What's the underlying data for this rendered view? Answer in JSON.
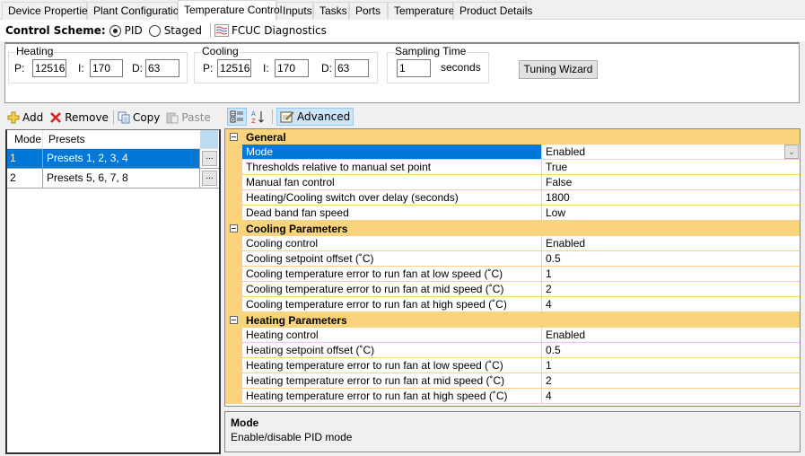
{
  "tabs": [
    {
      "label": "Device Properties",
      "active": false
    },
    {
      "label": "Plant Configuration",
      "active": false
    },
    {
      "label": "Temperature Control",
      "active": true
    },
    {
      "label": "Inputs",
      "active": false
    },
    {
      "label": "Tasks",
      "active": false
    },
    {
      "label": "Ports",
      "active": false
    },
    {
      "label": "Temperature",
      "active": false
    },
    {
      "label": "Product Details",
      "active": false
    }
  ],
  "scheme": {
    "label": "Control Scheme:",
    "options": [
      {
        "label": "PID",
        "selected": true
      },
      {
        "label": "Staged",
        "selected": false
      }
    ],
    "diagnostics_label": "FCUC Diagnostics"
  },
  "pid": {
    "heating": {
      "title": "Heating",
      "p_label": "P:",
      "i_label": "I:",
      "d_label": "D:",
      "p": "12516",
      "i": "170",
      "d": "63"
    },
    "cooling": {
      "title": "Cooling",
      "p_label": "P:",
      "i_label": "I:",
      "d_label": "D:",
      "p": "12516",
      "i": "170",
      "d": "63"
    },
    "sampling": {
      "title": "Sampling Time",
      "value": "1",
      "unit": "seconds"
    },
    "tuning_wizard_label": "Tuning Wizard"
  },
  "left_toolbar": {
    "add": "Add",
    "remove": "Remove",
    "copy": "Copy",
    "paste": "Paste"
  },
  "modes_grid": {
    "columns": [
      "Mode",
      "Presets"
    ],
    "rows": [
      {
        "mode": "1",
        "presets": "Presets 1, 2, 3, 4",
        "selected": true,
        "button": "..."
      },
      {
        "mode": "2",
        "presets": "Presets 5, 6, 7, 8",
        "selected": false,
        "button": "..."
      }
    ]
  },
  "right_toolbar": {
    "advanced_label": "Advanced"
  },
  "property_grid": {
    "categories": [
      {
        "name": "General",
        "rows": [
          {
            "name": "Mode",
            "value": "Enabled",
            "selected": true
          },
          {
            "name": "Thresholds relative to manual set point",
            "value": "True"
          },
          {
            "name": "Manual fan control",
            "value": "False"
          },
          {
            "name": "Heating/Cooling switch over delay (seconds)",
            "value": "1800"
          },
          {
            "name": "Dead band fan speed",
            "value": "Low"
          }
        ]
      },
      {
        "name": "Cooling Parameters",
        "rows": [
          {
            "name": "Cooling control",
            "value": "Enabled"
          },
          {
            "name": "Cooling setpoint offset (˚C)",
            "value": "0.5"
          },
          {
            "name": "Cooling temperature error to run fan at low speed (˚C)",
            "value": "1"
          },
          {
            "name": "Cooling temperature error to run fan at mid speed (˚C)",
            "value": "2"
          },
          {
            "name": "Cooling temperature error to run fan at high speed (˚C)",
            "value": "4"
          }
        ]
      },
      {
        "name": "Heating Parameters",
        "rows": [
          {
            "name": "Heating control",
            "value": "Enabled"
          },
          {
            "name": "Heating setpoint offset (˚C)",
            "value": "0.5"
          },
          {
            "name": "Heating temperature error to run fan at low speed (˚C)",
            "value": "1"
          },
          {
            "name": "Heating temperature error to run fan at mid speed (˚C)",
            "value": "2"
          },
          {
            "name": "Heating temperature error to run fan at high speed (˚C)",
            "value": "4"
          }
        ]
      }
    ]
  },
  "description": {
    "title": "Mode",
    "text": "Enable/disable PID mode"
  },
  "colors": {
    "selection": "#0078d7",
    "category_band": "#fad47c"
  }
}
